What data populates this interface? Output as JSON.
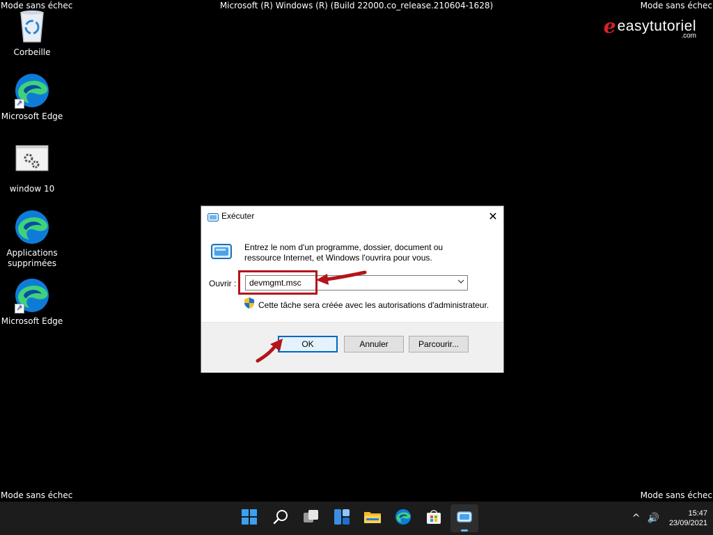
{
  "overlay": {
    "safe_mode_label": "Mode sans échec",
    "build_string": "Microsoft (R) Windows (R) (Build 22000.co_release.210604-1628)",
    "watermark": {
      "mark": "e",
      "name": "easytutoriel",
      "suffix": ".com",
      "mark_color": "#d9202a"
    }
  },
  "desktop": {
    "icons": [
      {
        "label": "Corbeille",
        "icon": "recycle-bin-icon"
      },
      {
        "label": "Microsoft Edge",
        "icon": "edge-icon"
      },
      {
        "label": "window 10",
        "icon": "settings-shortcut-icon"
      },
      {
        "label_line1": "Applications",
        "label_line2": "supprimées",
        "icon": "edge-icon"
      },
      {
        "label": "Microsoft Edge",
        "icon": "edge-icon"
      }
    ]
  },
  "run_dialog": {
    "title": "Exécuter",
    "close_glyph": "✕",
    "description_line1": "Entrez le nom d'un programme, dossier, document ou",
    "description_line2": "ressource Internet, et Windows l'ouvrira pour vous.",
    "open_label": "Ouvrir :",
    "open_value": "devmgmt.msc",
    "admin_note": "Cette tâche sera créée avec les autorisations d'administrateur.",
    "buttons": {
      "ok": "OK",
      "cancel": "Annuler",
      "browse": "Parcourir..."
    },
    "annotation_color": "#b4141a"
  },
  "taskbar": {
    "apps": [
      "start-icon",
      "search-icon",
      "task-view-icon",
      "widgets-icon",
      "file-explorer-icon",
      "edge-icon",
      "store-icon",
      "run-icon"
    ],
    "active_app": "run-icon",
    "tray": {
      "chevron": "^",
      "speaker": "🔊"
    },
    "time": "15:47",
    "date": "23/09/2021"
  }
}
